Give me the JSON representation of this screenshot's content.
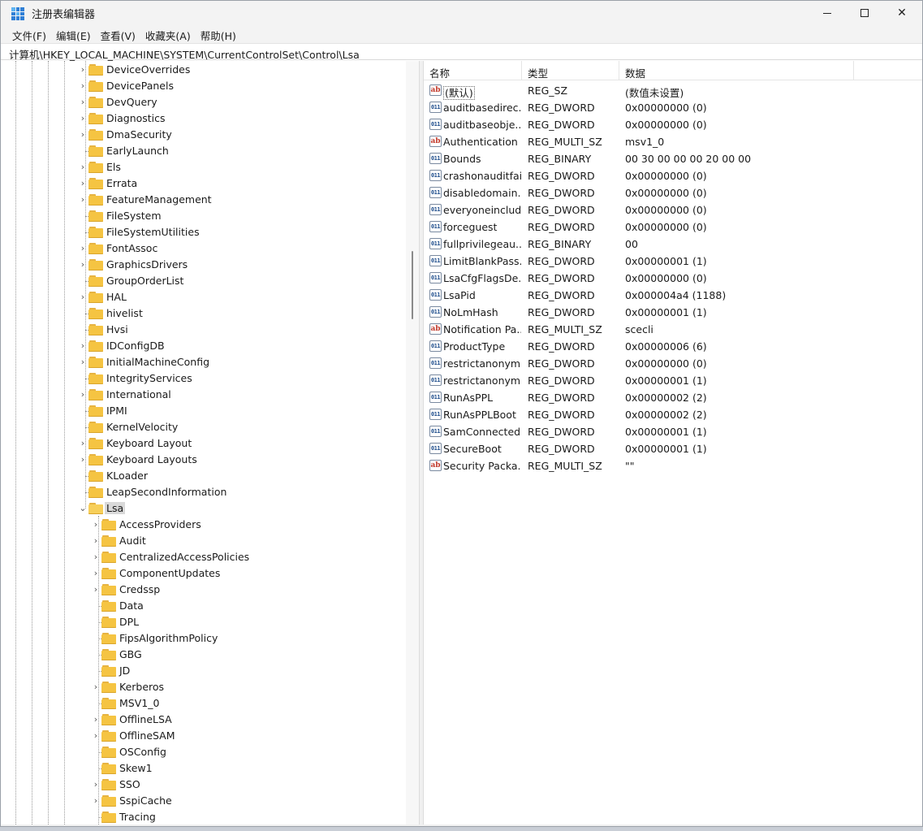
{
  "window": {
    "title": "注册表编辑器"
  },
  "menu": [
    "文件(F)",
    "编辑(E)",
    "查看(V)",
    "收藏夹(A)",
    "帮助(H)"
  ],
  "address": "计算机\\HKEY_LOCAL_MACHINE\\SYSTEM\\CurrentControlSet\\Control\\Lsa",
  "tree": [
    {
      "label": "DeviceOverrides",
      "level": 1,
      "expandable": true
    },
    {
      "label": "DevicePanels",
      "level": 1,
      "expandable": true
    },
    {
      "label": "DevQuery",
      "level": 1,
      "expandable": true
    },
    {
      "label": "Diagnostics",
      "level": 1,
      "expandable": true
    },
    {
      "label": "DmaSecurity",
      "level": 1,
      "expandable": true
    },
    {
      "label": "EarlyLaunch",
      "level": 1,
      "expandable": false
    },
    {
      "label": "Els",
      "level": 1,
      "expandable": true
    },
    {
      "label": "Errata",
      "level": 1,
      "expandable": true
    },
    {
      "label": "FeatureManagement",
      "level": 1,
      "expandable": true
    },
    {
      "label": "FileSystem",
      "level": 1,
      "expandable": false
    },
    {
      "label": "FileSystemUtilities",
      "level": 1,
      "expandable": false
    },
    {
      "label": "FontAssoc",
      "level": 1,
      "expandable": true
    },
    {
      "label": "GraphicsDrivers",
      "level": 1,
      "expandable": true
    },
    {
      "label": "GroupOrderList",
      "level": 1,
      "expandable": false
    },
    {
      "label": "HAL",
      "level": 1,
      "expandable": true
    },
    {
      "label": "hivelist",
      "level": 1,
      "expandable": false
    },
    {
      "label": "Hvsi",
      "level": 1,
      "expandable": false
    },
    {
      "label": "IDConfigDB",
      "level": 1,
      "expandable": true
    },
    {
      "label": "InitialMachineConfig",
      "level": 1,
      "expandable": true
    },
    {
      "label": "IntegrityServices",
      "level": 1,
      "expandable": false
    },
    {
      "label": "International",
      "level": 1,
      "expandable": true
    },
    {
      "label": "IPMI",
      "level": 1,
      "expandable": false
    },
    {
      "label": "KernelVelocity",
      "level": 1,
      "expandable": false
    },
    {
      "label": "Keyboard Layout",
      "level": 1,
      "expandable": true
    },
    {
      "label": "Keyboard Layouts",
      "level": 1,
      "expandable": true
    },
    {
      "label": "KLoader",
      "level": 1,
      "expandable": false
    },
    {
      "label": "LeapSecondInformation",
      "level": 1,
      "expandable": false
    },
    {
      "label": "Lsa",
      "level": 1,
      "expandable": true,
      "expanded": true,
      "selected": true
    },
    {
      "label": "AccessProviders",
      "level": 2,
      "expandable": true
    },
    {
      "label": "Audit",
      "level": 2,
      "expandable": true
    },
    {
      "label": "CentralizedAccessPolicies",
      "level": 2,
      "expandable": true
    },
    {
      "label": "ComponentUpdates",
      "level": 2,
      "expandable": true
    },
    {
      "label": "Credssp",
      "level": 2,
      "expandable": true
    },
    {
      "label": "Data",
      "level": 2,
      "expandable": false
    },
    {
      "label": "DPL",
      "level": 2,
      "expandable": false
    },
    {
      "label": "FipsAlgorithmPolicy",
      "level": 2,
      "expandable": false
    },
    {
      "label": "GBG",
      "level": 2,
      "expandable": false
    },
    {
      "label": "JD",
      "level": 2,
      "expandable": false
    },
    {
      "label": "Kerberos",
      "level": 2,
      "expandable": true
    },
    {
      "label": "MSV1_0",
      "level": 2,
      "expandable": false
    },
    {
      "label": "OfflineLSA",
      "level": 2,
      "expandable": true
    },
    {
      "label": "OfflineSAM",
      "level": 2,
      "expandable": true
    },
    {
      "label": "OSConfig",
      "level": 2,
      "expandable": false
    },
    {
      "label": "Skew1",
      "level": 2,
      "expandable": false
    },
    {
      "label": "SSO",
      "level": 2,
      "expandable": true
    },
    {
      "label": "SspiCache",
      "level": 2,
      "expandable": true
    },
    {
      "label": "Tracing",
      "level": 2,
      "expandable": false
    }
  ],
  "list": {
    "headers": {
      "name": "名称",
      "type": "类型",
      "data": "数据"
    },
    "rows": [
      {
        "icon": "string-value-icon",
        "name": "(默认)",
        "type": "REG_SZ",
        "data": "(数值未设置)",
        "is_default": true
      },
      {
        "icon": "binary-value-icon",
        "name": "auditbasedirec...",
        "type": "REG_DWORD",
        "data": "0x00000000 (0)"
      },
      {
        "icon": "binary-value-icon",
        "name": "auditbaseobje...",
        "type": "REG_DWORD",
        "data": "0x00000000 (0)"
      },
      {
        "icon": "string-value-icon",
        "name": "Authentication ...",
        "type": "REG_MULTI_SZ",
        "data": "msv1_0"
      },
      {
        "icon": "binary-value-icon",
        "name": "Bounds",
        "type": "REG_BINARY",
        "data": "00 30 00 00 00 20 00 00"
      },
      {
        "icon": "binary-value-icon",
        "name": "crashonauditfail",
        "type": "REG_DWORD",
        "data": "0x00000000 (0)"
      },
      {
        "icon": "binary-value-icon",
        "name": "disabledomain...",
        "type": "REG_DWORD",
        "data": "0x00000000 (0)"
      },
      {
        "icon": "binary-value-icon",
        "name": "everyoneinclud...",
        "type": "REG_DWORD",
        "data": "0x00000000 (0)"
      },
      {
        "icon": "binary-value-icon",
        "name": "forceguest",
        "type": "REG_DWORD",
        "data": "0x00000000 (0)"
      },
      {
        "icon": "binary-value-icon",
        "name": "fullprivilegeau...",
        "type": "REG_BINARY",
        "data": "00"
      },
      {
        "icon": "binary-value-icon",
        "name": "LimitBlankPass...",
        "type": "REG_DWORD",
        "data": "0x00000001 (1)"
      },
      {
        "icon": "binary-value-icon",
        "name": "LsaCfgFlagsDe...",
        "type": "REG_DWORD",
        "data": "0x00000000 (0)"
      },
      {
        "icon": "binary-value-icon",
        "name": "LsaPid",
        "type": "REG_DWORD",
        "data": "0x000004a4 (1188)"
      },
      {
        "icon": "binary-value-icon",
        "name": "NoLmHash",
        "type": "REG_DWORD",
        "data": "0x00000001 (1)"
      },
      {
        "icon": "string-value-icon",
        "name": "Notification Pa...",
        "type": "REG_MULTI_SZ",
        "data": "scecli"
      },
      {
        "icon": "binary-value-icon",
        "name": "ProductType",
        "type": "REG_DWORD",
        "data": "0x00000006 (6)"
      },
      {
        "icon": "binary-value-icon",
        "name": "restrictanonym...",
        "type": "REG_DWORD",
        "data": "0x00000000 (0)"
      },
      {
        "icon": "binary-value-icon",
        "name": "restrictanonym...",
        "type": "REG_DWORD",
        "data": "0x00000001 (1)"
      },
      {
        "icon": "binary-value-icon",
        "name": "RunAsPPL",
        "type": "REG_DWORD",
        "data": "0x00000002 (2)"
      },
      {
        "icon": "binary-value-icon",
        "name": "RunAsPPLBoot",
        "type": "REG_DWORD",
        "data": "0x00000002 (2)"
      },
      {
        "icon": "binary-value-icon",
        "name": "SamConnected...",
        "type": "REG_DWORD",
        "data": "0x00000001 (1)"
      },
      {
        "icon": "binary-value-icon",
        "name": "SecureBoot",
        "type": "REG_DWORD",
        "data": "0x00000001 (1)"
      },
      {
        "icon": "string-value-icon",
        "name": "Security Packa...",
        "type": "REG_MULTI_SZ",
        "data": "\"\""
      }
    ]
  }
}
